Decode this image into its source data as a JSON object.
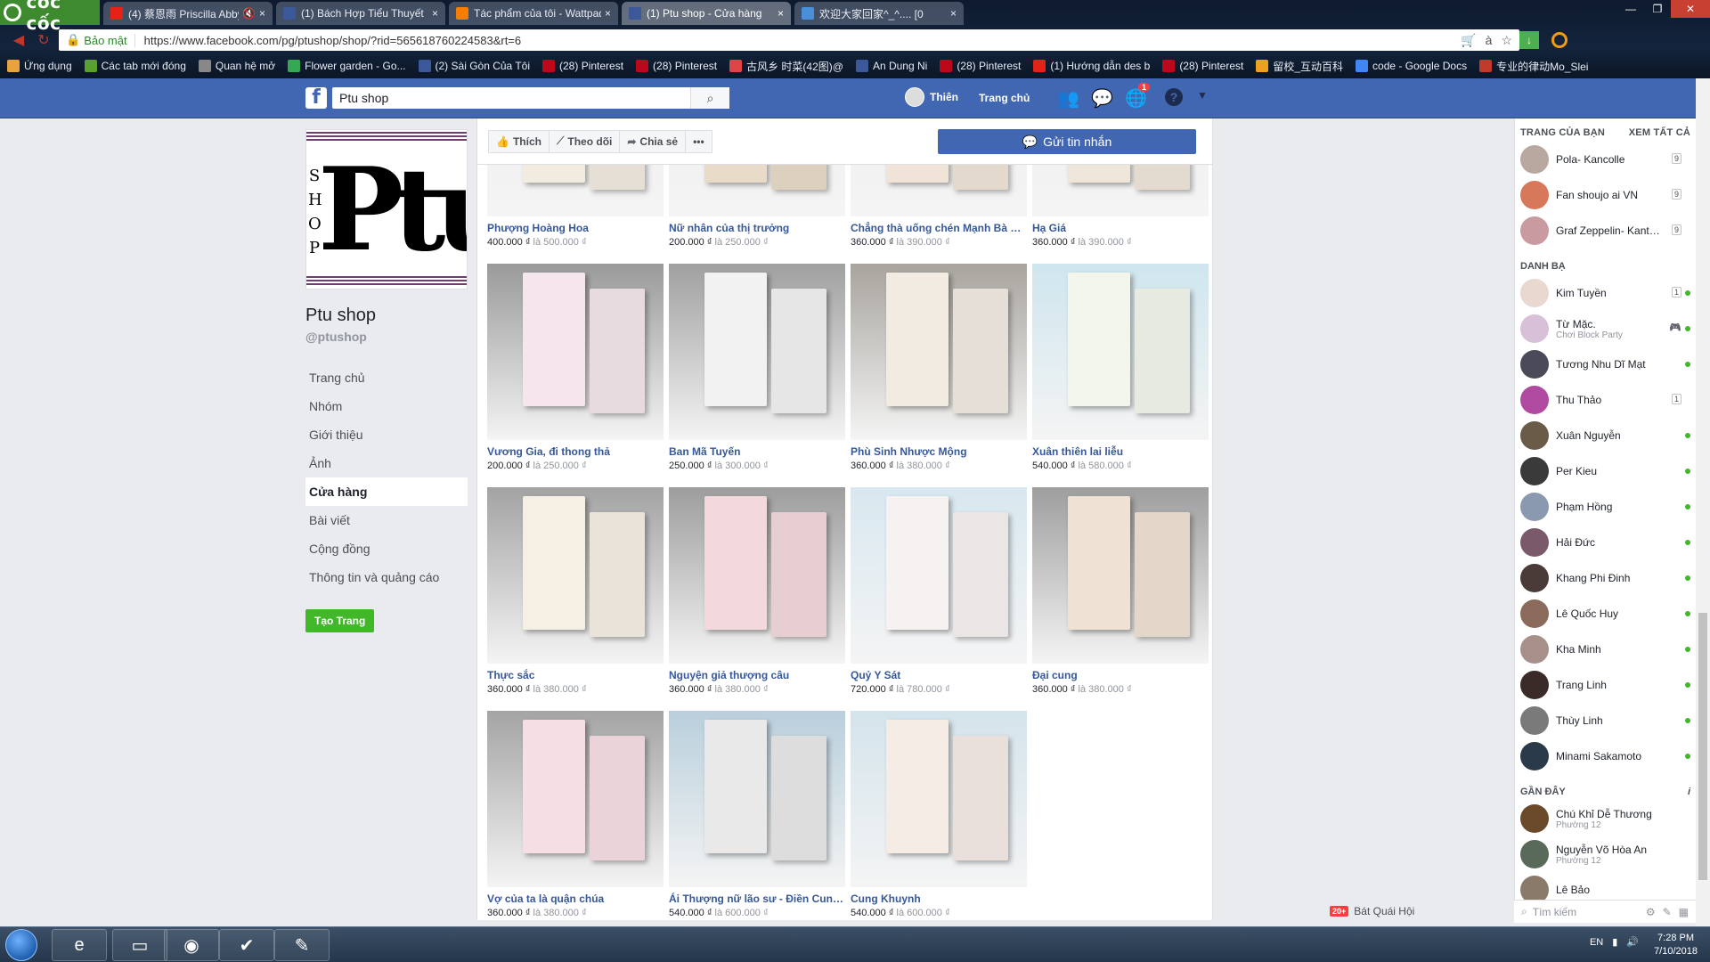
{
  "browser": {
    "logo_text": "cốc cốc",
    "tabs": [
      {
        "title": "(4) 蔡恩雨 Priscilla Abby",
        "icon": "youtube-icon",
        "color": "#e62117",
        "audio": "🔇"
      },
      {
        "title": "(1) Bách Hợp Tiểu Thuyết",
        "icon": "facebook-icon",
        "color": "#3b5998"
      },
      {
        "title": "Tác phẩm của tôi - Wattpad",
        "icon": "wattpad-icon",
        "color": "#f57d00"
      },
      {
        "title": "(1) Ptu shop - Cửa hàng",
        "icon": "facebook-icon",
        "color": "#3b5998",
        "active": true
      },
      {
        "title": "欢迎大家回家^_^.... [0",
        "icon": "globe-icon",
        "color": "#4a90d9"
      }
    ],
    "address": {
      "secure_label": "Bảo mật",
      "url": "https://www.facebook.com/pg/ptushop/shop/?rid=565618760224583&rt=6"
    },
    "bookmarks": [
      {
        "label": "Ứng dụng",
        "icon": "apps-icon",
        "color": "#e8a33d"
      },
      {
        "label": "Các tab mới đóng",
        "icon": "coccoc-icon",
        "color": "#5aa02c"
      },
      {
        "label": "Quan hệ mở",
        "icon": "page-icon",
        "color": "#888888"
      },
      {
        "label": "Flower garden - Go...",
        "icon": "google-drive-icon",
        "color": "#34a853"
      },
      {
        "label": "(2) Sài Gòn Của Tôi",
        "icon": "facebook-icon",
        "color": "#3b5998"
      },
      {
        "label": "(28) Pinterest",
        "icon": "pinterest-icon",
        "color": "#bd081c"
      },
      {
        "label": "(28) Pinterest",
        "icon": "pinterest-icon",
        "color": "#bd081c"
      },
      {
        "label": "古风乡 时菜(42图)@",
        "icon": "bookmark-icon",
        "color": "#d44"
      },
      {
        "label": "An Dung Ni",
        "icon": "facebook-icon",
        "color": "#3b5998"
      },
      {
        "label": "(28) Pinterest",
        "icon": "pinterest-icon",
        "color": "#bd081c"
      },
      {
        "label": "(1) Hướng dẫn des b",
        "icon": "youtube-icon",
        "color": "#e62117"
      },
      {
        "label": "(28) Pinterest",
        "icon": "pinterest-icon",
        "color": "#bd081c"
      },
      {
        "label": "留校_互动百科",
        "icon": "baike-icon",
        "color": "#f0a020"
      },
      {
        "label": "code - Google Docs",
        "icon": "google-docs-icon",
        "color": "#4285f4"
      },
      {
        "label": "专业的律动Mo_Slei",
        "icon": "bookmark-icon",
        "color": "#c0392b"
      }
    ]
  },
  "fb": {
    "search_value": "Ptu shop",
    "user_name": "Thiên",
    "home_label": "Trang chủ",
    "notif_badge": "1"
  },
  "page": {
    "logo_letters": "SHOP",
    "logo_text": "Ptu",
    "name": "Ptu shop",
    "handle": "@ptushop",
    "nav": [
      {
        "label": "Trang chủ"
      },
      {
        "label": "Nhóm"
      },
      {
        "label": "Giới thiệu"
      },
      {
        "label": "Ảnh"
      },
      {
        "label": "Cửa hàng",
        "active": true
      },
      {
        "label": "Bài viết"
      },
      {
        "label": "Cộng đồng"
      },
      {
        "label": "Thông tin và quảng cáo"
      }
    ],
    "create_button": "Tạo Trang"
  },
  "actions": {
    "like": "Thích",
    "follow": "Theo dõi",
    "share": "Chia sẻ",
    "more": "•••",
    "send": "Gửi tin nhắn"
  },
  "products": [
    {
      "name": "Phượng Hoàng Hoa",
      "price": "400.000 ₫",
      "old": "là 500.000 ₫",
      "bg": "#ececec",
      "book": "#f2ebe0"
    },
    {
      "name": "Nữ nhân của thị trưởng",
      "price": "200.000 ₫",
      "old": "là 250.000 ₫",
      "bg": "#ececec",
      "book": "#e8dcc8"
    },
    {
      "name": "Chẳng thà uống chén Mạnh Bà Thang",
      "price": "360.000 ₫",
      "old": "là 390.000 ₫",
      "bg": "#ececec",
      "book": "#f0e4d8"
    },
    {
      "name": "Hạ Giá",
      "price": "360.000 ₫",
      "old": "là 390.000 ₫",
      "bg": "#ececec",
      "book": "#efe6da"
    },
    {
      "name": "Vương Gia, đi thong thả",
      "price": "200.000 ₫",
      "old": "là 250.000 ₫",
      "bg": "#9a9a9a",
      "book": "#f4e6ec"
    },
    {
      "name": "Ban Mã Tuyến",
      "price": "250.000 ₫",
      "old": "là 300.000 ₫",
      "bg": "#a0a0a0",
      "book": "#f2f2f2"
    },
    {
      "name": "Phù Sinh Nhược Mộng",
      "price": "360.000 ₫",
      "old": "là 380.000 ₫",
      "bg": "#a8a49e",
      "book": "#f1ebe2"
    },
    {
      "name": "Xuân thiên lai liễu",
      "price": "540.000 ₫",
      "old": "là 580.000 ₫",
      "bg": "#cfe6ee",
      "book": "#f3f6ec"
    },
    {
      "name": "Thực sắc",
      "price": "360.000 ₫",
      "old": "là 380.000 ₫",
      "bg": "#a3a3a3",
      "book": "#f5efe4"
    },
    {
      "name": "Nguyện giả thượng câu",
      "price": "360.000 ₫",
      "old": "là 380.000 ₫",
      "bg": "#9d9d9d",
      "book": "#f3d9dc"
    },
    {
      "name": "Quỷ Y Sát",
      "price": "720.000 ₫",
      "old": "là 780.000 ₫",
      "bg": "#d8e8f0",
      "book": "#f7f2f2"
    },
    {
      "name": "Đại cung",
      "price": "360.000 ₫",
      "old": "là 380.000 ₫",
      "bg": "#9e9e9e",
      "book": "#efe2d4"
    },
    {
      "name": "Vợ của ta là quận chúa",
      "price": "360.000 ₫",
      "old": "là 380.000 ₫",
      "bg": "#a4a4a4",
      "book": "#f6dfe4"
    },
    {
      "name": "Ái Thượng nữ lão sư - Điền Cung Sư",
      "price": "540.000 ₫",
      "old": "là 600.000 ₫",
      "bg": "#b9cfdc",
      "book": "#e9e9e9"
    },
    {
      "name": "Cung Khuynh",
      "price": "540.000 ₫",
      "old": "là 600.000 ₫",
      "bg": "#d4e4ec",
      "book": "#f5ece6"
    }
  ],
  "sidebar": {
    "pages_title": "TRANG CỦA BẠN",
    "see_all": "XEM TẤT CẢ",
    "pages": [
      {
        "name": "Pola- Kancolle",
        "color": "#b9a8a0",
        "count": "9"
      },
      {
        "name": "Fan shoujo ai VN",
        "color": "#d8785a",
        "count": "9"
      },
      {
        "name": "Graf Zeppelin- Kantai ...",
        "color": "#c99aa0",
        "count": "9"
      }
    ],
    "contacts_title": "DANH BẠ",
    "contacts": [
      {
        "name": "Kim Tuyền",
        "color": "#e8d8d0",
        "count": "1",
        "online": true
      },
      {
        "name": "Từ Mặc.",
        "sub": "Chơi Block Party",
        "color": "#d8c0d8",
        "game": "🎮",
        "online": true
      },
      {
        "name": "Tương Nhu Dĩ Mạt",
        "color": "#4a4a58",
        "online": true
      },
      {
        "name": "Thu Thảo",
        "color": "#b04aa0",
        "count": "1",
        "online": false
      },
      {
        "name": "Xuân Nguyễn",
        "color": "#6a5a48",
        "online": true
      },
      {
        "name": "Per Kieu",
        "color": "#3a3a3a",
        "online": true
      },
      {
        "name": "Phạm Hồng",
        "color": "#8a98b0",
        "online": true
      },
      {
        "name": "Hải Đức",
        "color": "#7a5a6a",
        "online": true
      },
      {
        "name": "Khang Phi Đinh",
        "color": "#4a3a38",
        "online": true
      },
      {
        "name": "Lê Quốc Huy",
        "color": "#8a6a5a",
        "online": true
      },
      {
        "name": "Kha Minh",
        "color": "#a8908a",
        "online": true
      },
      {
        "name": "Trang Linh",
        "color": "#3a2a28",
        "online": true
      },
      {
        "name": "Thùy Linh",
        "color": "#7a7a7a",
        "online": true
      },
      {
        "name": "Minami Sakamoto",
        "color": "#2a3a4a",
        "online": true
      }
    ],
    "recent_title": "GẦN ĐÂY",
    "recent_info": "i",
    "recent": [
      {
        "name": "Chú Khỉ Dễ Thương",
        "sub": "Phường 12",
        "color": "#6a4a2a"
      },
      {
        "name": "Nguyễn Võ Hòa An",
        "sub": "Phường 12",
        "color": "#5a6a5a"
      },
      {
        "name": "Lê Bảo",
        "color": "#8a7a6a"
      }
    ],
    "chat_search": "Tìm kiếm"
  },
  "chat_tab": {
    "badge": "20+",
    "label": "Bát Quái Hội"
  },
  "taskbar": {
    "lang": "EN",
    "time": "7:28 PM",
    "date": "7/10/2018"
  }
}
